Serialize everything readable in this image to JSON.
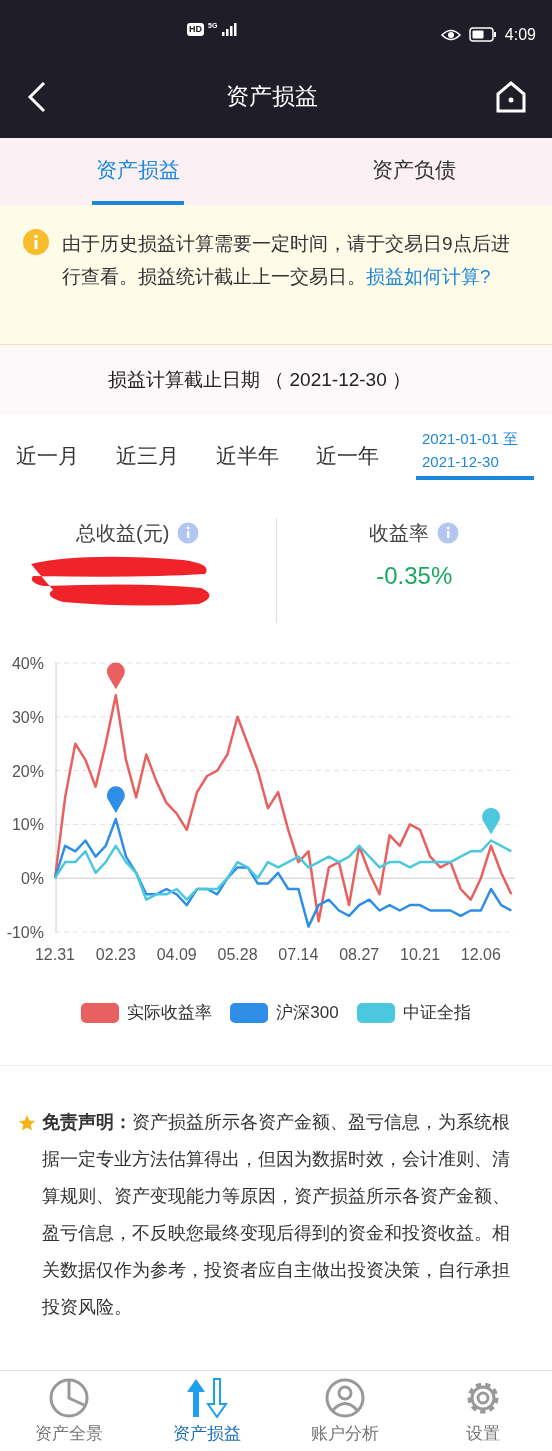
{
  "status_bar": {
    "hd_badge": "HD",
    "network": "5G",
    "time": "4:09"
  },
  "header": {
    "title": "资产损益"
  },
  "tabs": [
    {
      "label": "资产损益",
      "selected": true
    },
    {
      "label": "资产负债",
      "selected": false
    }
  ],
  "notice": {
    "text": "由于历史损益计算需要一定时间，请于交易日9点后进行查看。损益统计截止上一交易日。",
    "link": "损益如何计算?"
  },
  "cutoff_date": "损益计算截止日期 （ 2021-12-30 ）",
  "periods": [
    {
      "kind": "label",
      "label": "近一月",
      "selected": false
    },
    {
      "kind": "label",
      "label": "近三月",
      "selected": false
    },
    {
      "kind": "label",
      "label": "近半年",
      "selected": false
    },
    {
      "kind": "label",
      "label": "近一年",
      "selected": false
    },
    {
      "kind": "range",
      "start": "2021-01-01",
      "separator": "至",
      "end": "2021-12-30",
      "selected": true
    }
  ],
  "summary": [
    {
      "label": "总收益(元)",
      "redacted": true
    },
    {
      "label": "收益率",
      "value": "-0.35%"
    }
  ],
  "chart_data": {
    "type": "line",
    "categories": [
      "12.31",
      null,
      null,
      null,
      null,
      null,
      "02.23",
      null,
      null,
      null,
      null,
      null,
      "04.09",
      null,
      null,
      null,
      null,
      null,
      "05.28",
      null,
      null,
      null,
      null,
      null,
      "07.14",
      null,
      null,
      null,
      null,
      null,
      "08.27",
      null,
      null,
      null,
      null,
      null,
      "10.21",
      null,
      null,
      null,
      null,
      null,
      "12.06",
      null,
      null,
      null
    ],
    "ylim": [
      -10,
      40
    ],
    "grid": true,
    "yticks": [
      {
        "value": 40,
        "label": "40%"
      },
      {
        "value": 30,
        "label": "30%"
      },
      {
        "value": 20,
        "label": "20%"
      },
      {
        "value": 10,
        "label": "10%"
      },
      {
        "value": 0,
        "label": "0%"
      },
      {
        "value": -10,
        "label": "-10%"
      }
    ],
    "series": [
      {
        "name": "实际收益率",
        "color": "#e8605f",
        "values": [
          0,
          15,
          25,
          22,
          17,
          25,
          34,
          22,
          15,
          23,
          18,
          14,
          12,
          9,
          16,
          19,
          20,
          23,
          30,
          25,
          20,
          13,
          16,
          9,
          3,
          5,
          -8,
          2,
          3,
          -5,
          6,
          1,
          -3,
          8,
          6,
          10,
          9,
          4,
          2,
          3,
          -2,
          -4,
          0,
          6,
          1,
          -3
        ]
      },
      {
        "name": "沪深300",
        "color": "#2f8ee6",
        "values": [
          0,
          6,
          5,
          7,
          4,
          6,
          11,
          4,
          1,
          -3,
          -3,
          -2,
          -3,
          -5,
          -2,
          -2,
          -3,
          0,
          2,
          2,
          -1,
          -1,
          1,
          -2,
          -2,
          -9,
          -5,
          -4,
          -6,
          -7,
          -5,
          -4,
          -6,
          -5,
          -6,
          -5,
          -5,
          -6,
          -6,
          -6,
          -7,
          -6,
          -6,
          -2,
          -5,
          -6
        ]
      },
      {
        "name": "中证全指",
        "color": "#4cc8de",
        "values": [
          0,
          3,
          3,
          5,
          1,
          3,
          6,
          3,
          1,
          -4,
          -3,
          -3,
          -2,
          -4,
          -2,
          -2,
          -2,
          0,
          3,
          2,
          0,
          3,
          2,
          3,
          4,
          2,
          3,
          4,
          3,
          4,
          6,
          4,
          2,
          3,
          3,
          2,
          3,
          3,
          3,
          3,
          4,
          5,
          5,
          7,
          6,
          5
        ]
      }
    ]
  },
  "disclaimer": "**免责声明：**资产损益所示各资产金额、盈亏信息，为系统根据一定专业方法估算得出，但因为数据时效，会计准则、清算规则、资产变现能力等原因，资产损益所示各资产金额、盈亏信息，不反映您最终变现后得到的资金和投资收益。相关数据仅作为参考，投资者应自主做出投资决策，自行承担投资风险。",
  "bottom_nav": [
    {
      "label": "资产全景",
      "selected": false
    },
    {
      "label": "资产损益",
      "selected": true
    },
    {
      "label": "账户分析",
      "selected": false
    },
    {
      "label": "设置",
      "selected": false
    }
  ]
}
